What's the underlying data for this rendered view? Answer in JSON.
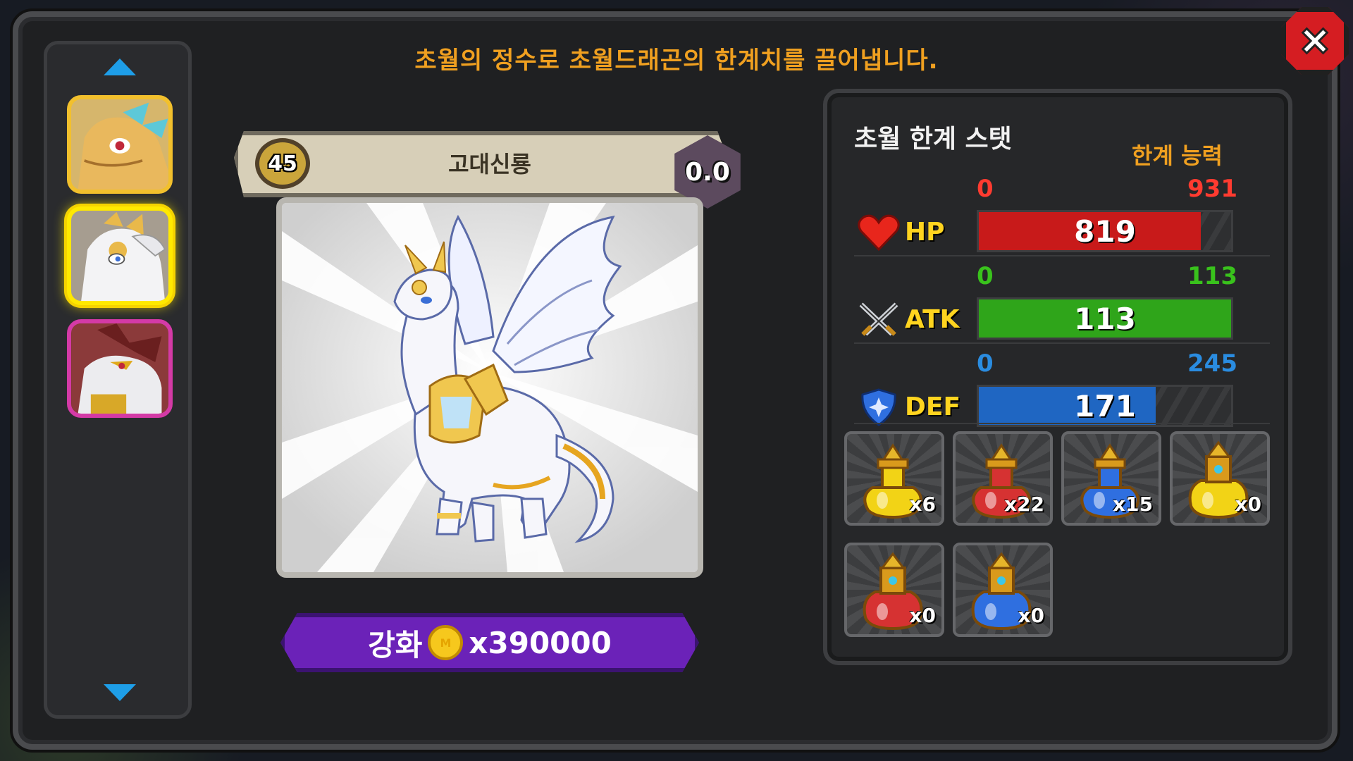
{
  "close_label": "close",
  "headline": "초월의 정수로 초월드래곤의 한계치를 끌어냅니다.",
  "dragon": {
    "level": "45",
    "name": "고대신룡",
    "grade": "0.0"
  },
  "upgrade": {
    "label": "강화",
    "coin_mark": "M",
    "cost": "x390000"
  },
  "stats_panel": {
    "title": "초월 한계 스탯",
    "subtitle": "한계 능력",
    "stats": [
      {
        "label": "HP",
        "min": "0",
        "max": "931",
        "value": "819",
        "fill_fraction": 0.88,
        "min_color": "#ff3b30",
        "max_color": "#ff3b30",
        "fill_color": "#c81a1a",
        "icon": "heart-icon"
      },
      {
        "label": "ATK",
        "min": "0",
        "max": "113",
        "value": "113",
        "fill_fraction": 1.0,
        "min_color": "#39c21c",
        "max_color": "#39c21c",
        "fill_color": "#2fa51a",
        "icon": "crossed-swords-icon"
      },
      {
        "label": "DEF",
        "min": "0",
        "max": "245",
        "value": "171",
        "fill_fraction": 0.7,
        "min_color": "#2a8ce0",
        "max_color": "#2a8ce0",
        "fill_color": "#1f66c2",
        "icon": "shield-icon"
      }
    ]
  },
  "potions": [
    {
      "count": "x6",
      "color": "#f2d316",
      "icon": "yellow-potion-icon"
    },
    {
      "count": "x22",
      "color": "#d63232",
      "icon": "red-potion-icon"
    },
    {
      "count": "x15",
      "color": "#2f6fe0",
      "icon": "blue-potion-icon"
    },
    {
      "count": "x0",
      "color": "#f2d316",
      "icon": "large-yellow-potion-icon"
    },
    {
      "count": "x0",
      "color": "#d63232",
      "icon": "large-red-potion-icon"
    },
    {
      "count": "x0",
      "color": "#2f6fe0",
      "icon": "large-blue-potion-icon"
    }
  ],
  "portraits": [
    {
      "name": "golden-dragon-portrait",
      "border": "#f2c02d"
    },
    {
      "name": "ancient-divine-dragon-portrait",
      "border": "#ffe900"
    },
    {
      "name": "red-white-dragon-portrait",
      "border": "#d43aa6"
    }
  ]
}
